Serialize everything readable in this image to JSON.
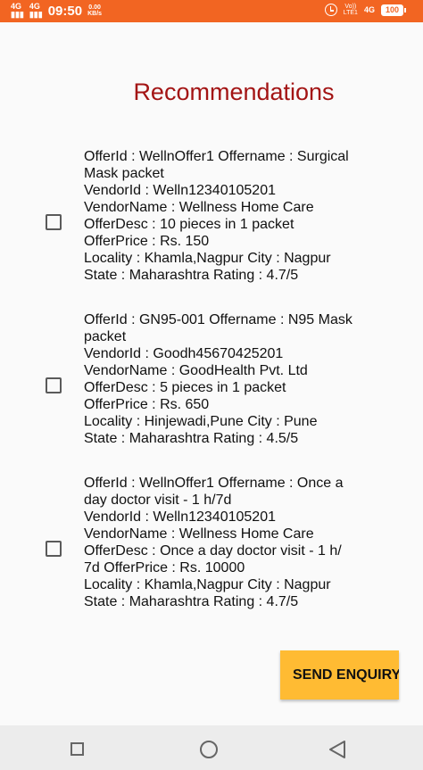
{
  "status_bar": {
    "network_left": "4G",
    "time": "09:50",
    "speed_value": "0.00",
    "speed_unit": "KB/s",
    "volte_label": "Vo))",
    "lte_label": "LTE1",
    "network_right": "4G",
    "battery": "100"
  },
  "title": "Recommendations",
  "offers": [
    {
      "lines": [
        "OfferId : WellnOffer1 Offername : Surgical",
        "Mask packet",
        "VendorId : Welln12340105201",
        "VendorName : Wellness Home Care",
        "OfferDesc : 10 pieces in 1 packet",
        "OfferPrice : Rs. 150",
        "Locality : Khamla,Nagpur City : Nagpur",
        "State : Maharashtra Rating : 4.7/5"
      ],
      "checked": false
    },
    {
      "lines": [
        "OfferId : GN95-001 Offername : N95 Mask",
        "packet",
        "VendorId : Goodh45670425201",
        "VendorName : GoodHealth Pvt. Ltd",
        "OfferDesc : 5 pieces in 1 packet",
        "OfferPrice : Rs. 650",
        "Locality : Hinjewadi,Pune City : Pune",
        "State : Maharashtra Rating : 4.5/5"
      ],
      "checked": false
    },
    {
      "lines": [
        "OfferId : WellnOffer1 Offername : Once a",
        "day doctor visit - 1 h/7d",
        "VendorId : Welln12340105201",
        "VendorName : Wellness Home Care",
        "OfferDesc : Once a day doctor visit - 1 h/",
        "7d OfferPrice : Rs. 10000",
        "Locality : Khamla,Nagpur City : Nagpur",
        "State : Maharashtra Rating : 4.7/5"
      ],
      "checked": false
    }
  ],
  "send_button": "SEND ENQUIRY",
  "nav": {
    "recent_icon": "square-icon",
    "home_icon": "circle-icon",
    "back_icon": "triangle-back-icon"
  }
}
